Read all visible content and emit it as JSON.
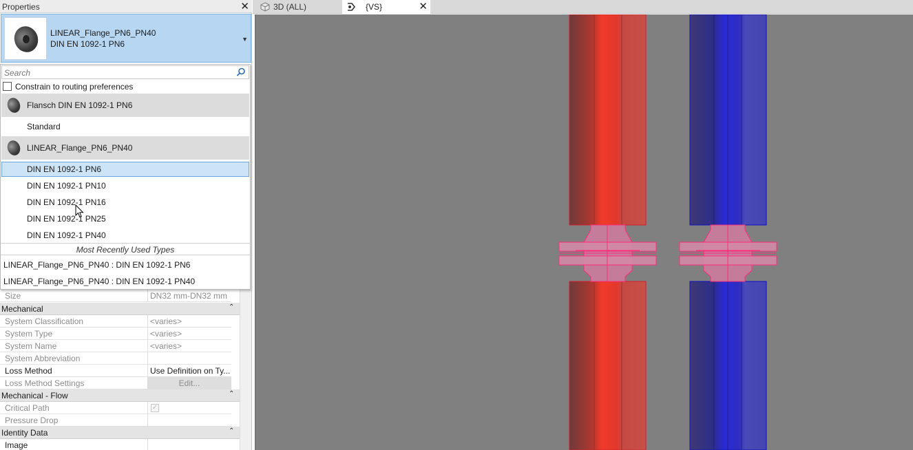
{
  "properties": {
    "title": "Properties",
    "type_selector": {
      "line1": "LINEAR_Flange_PN6_PN40",
      "line2": "DIN EN 1092-1 PN6"
    },
    "dropdown": {
      "search_placeholder": "Search",
      "constrain_label": "Constrain to routing preferences",
      "families": [
        {
          "name": "Flansch DIN EN 1092-1 PN6",
          "types": [
            "Standard"
          ]
        },
        {
          "name": "LINEAR_Flange_PN6_PN40",
          "types": [
            "DIN EN 1092-1 PN6",
            "DIN EN 1092-1 PN10",
            "DIN EN 1092-1 PN16",
            "DIN EN 1092-1 PN25",
            "DIN EN 1092-1 PN40"
          ]
        }
      ],
      "selected_type": "DIN EN 1092-1 PN6",
      "mru_header": "Most Recently Used Types",
      "mru_items": [
        "LINEAR_Flange_PN6_PN40 : DIN EN 1092-1 PN6",
        "LINEAR_Flange_PN6_PN40 : DIN EN 1092-1 PN40"
      ]
    },
    "grid": {
      "size_row": {
        "label": "Size",
        "value": "DN32 mm-DN32 mm"
      },
      "mechanical": {
        "label": "Mechanical",
        "rows": [
          {
            "label": "System Classification",
            "value": "<varies>"
          },
          {
            "label": "System Type",
            "value": "<varies>"
          },
          {
            "label": "System Name",
            "value": "<varies>"
          },
          {
            "label": "System Abbreviation",
            "value": ""
          },
          {
            "label": "Loss Method",
            "value": "Use Definition on Ty..."
          },
          {
            "label": "Loss Method Settings",
            "value": "Edit..."
          }
        ]
      },
      "mechanical_flow": {
        "label": "Mechanical - Flow",
        "rows": [
          {
            "label": "Critical Path",
            "value": "checked"
          },
          {
            "label": "Pressure Drop",
            "value": ""
          }
        ]
      },
      "identity_data": {
        "label": "Identity Data",
        "rows": [
          {
            "label": "Image",
            "value": ""
          }
        ]
      }
    }
  },
  "tabs": [
    {
      "label": "3D (ALL)",
      "icon": "3d-view-icon",
      "active": false
    },
    {
      "label": "{VS}",
      "icon": "section-view-icon",
      "active": true
    }
  ],
  "colors": {
    "hot_pipe": "#e8362a",
    "cold_pipe": "#3a3ac8",
    "flange_highlight": "#e9478c",
    "viewport_bg": "#808080",
    "selection_blue": "#b7d6f2"
  }
}
